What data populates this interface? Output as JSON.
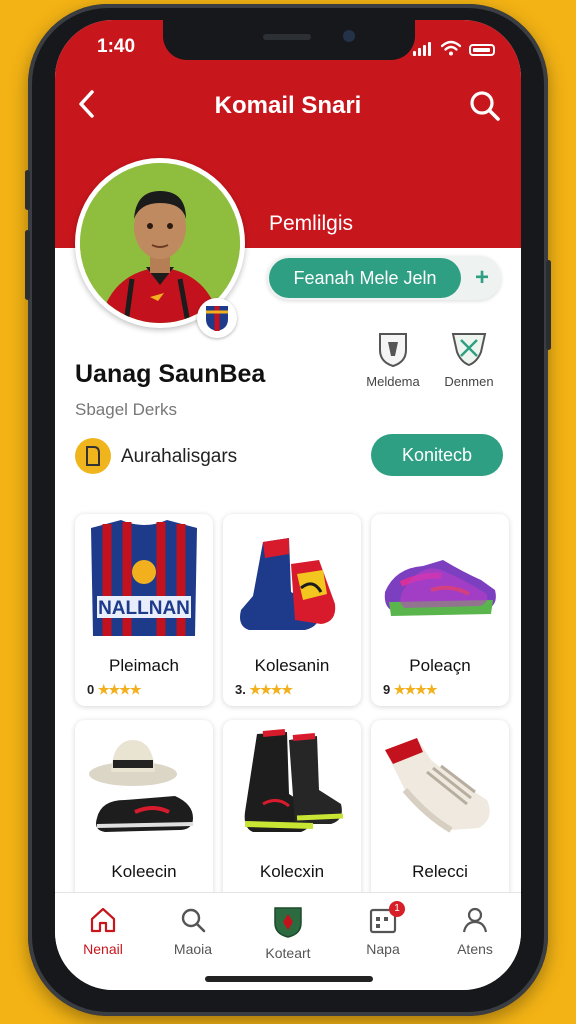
{
  "status_bar": {
    "time": "1:40"
  },
  "header": {
    "title": "Komail Snari"
  },
  "profile": {
    "tag": "Pemlilgis",
    "follow_label": "Feanah Mele Jeln",
    "follow_plus": "+",
    "name": "Uanag SaunBea",
    "subtitle": "Sbagel Derks",
    "achievement_label": "Aurahalisgars",
    "contact_label": "Konitecb",
    "badges": [
      {
        "label": "Meldema",
        "icon": "shield-icon"
      },
      {
        "label": "Denmen",
        "icon": "crest-icon"
      }
    ]
  },
  "products": [
    {
      "name": "Pleimach",
      "rating_prefix": "0",
      "stars": "★★★★"
    },
    {
      "name": "Kolesanin",
      "rating_prefix": "3.",
      "stars": "★★★★"
    },
    {
      "name": "Poleaçn",
      "rating_prefix": "9",
      "stars": "★★★★"
    },
    {
      "name": "Koleecin",
      "rating_prefix": "",
      "stars": ""
    },
    {
      "name": "Kolecxin",
      "rating_prefix": "",
      "stars": ""
    },
    {
      "name": "Relecci",
      "rating_prefix": "",
      "stars": ""
    }
  ],
  "jersey_print": "NALLNAN",
  "tabs": [
    {
      "label": "Nenail",
      "icon": "home-icon",
      "active": true
    },
    {
      "label": "Maoia",
      "icon": "search-icon"
    },
    {
      "label": "Koteart",
      "icon": "club-crest-icon"
    },
    {
      "label": "Napa",
      "icon": "calendar-icon",
      "badge": "1"
    },
    {
      "label": "Atens",
      "icon": "person-icon"
    }
  ],
  "colors": {
    "primary": "#c8161d",
    "accent": "#2e9f82",
    "star": "#f2b01e",
    "background": "#f3b315"
  }
}
